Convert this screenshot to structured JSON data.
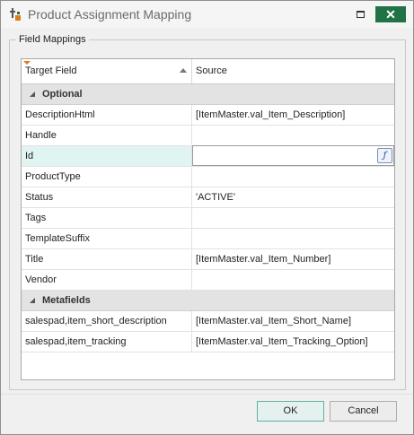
{
  "window": {
    "title": "Product Assignment Mapping",
    "accent_color": "#217346"
  },
  "group": {
    "label": "Field Mappings"
  },
  "grid": {
    "columns": [
      "Target Field",
      "Source"
    ],
    "rows": [
      {
        "type": "group",
        "label": "Optional"
      },
      {
        "type": "data",
        "target": "DescriptionHtml",
        "source": "[ItemMaster.val_Item_Description]"
      },
      {
        "type": "data",
        "target": "Handle",
        "source": ""
      },
      {
        "type": "data",
        "target": "Id",
        "source": "",
        "selected": true
      },
      {
        "type": "data",
        "target": "ProductType",
        "source": ""
      },
      {
        "type": "data",
        "target": "Status",
        "source": "'ACTIVE'"
      },
      {
        "type": "data",
        "target": "Tags",
        "source": ""
      },
      {
        "type": "data",
        "target": "TemplateSuffix",
        "source": ""
      },
      {
        "type": "data",
        "target": "Title",
        "source": "[ItemMaster.val_Item_Number]"
      },
      {
        "type": "data",
        "target": "Vendor",
        "source": ""
      },
      {
        "type": "group",
        "label": "Metafields"
      },
      {
        "type": "data",
        "target": "salespad,item_short_description",
        "source": "[ItemMaster.val_Item_Short_Name]"
      },
      {
        "type": "data",
        "target": "salespad,item_tracking",
        "source": "[ItemMaster.val_Item_Tracking_Option]"
      }
    ],
    "formula_button_icon": "function-icon"
  },
  "buttons": {
    "ok": "OK",
    "cancel": "Cancel"
  }
}
